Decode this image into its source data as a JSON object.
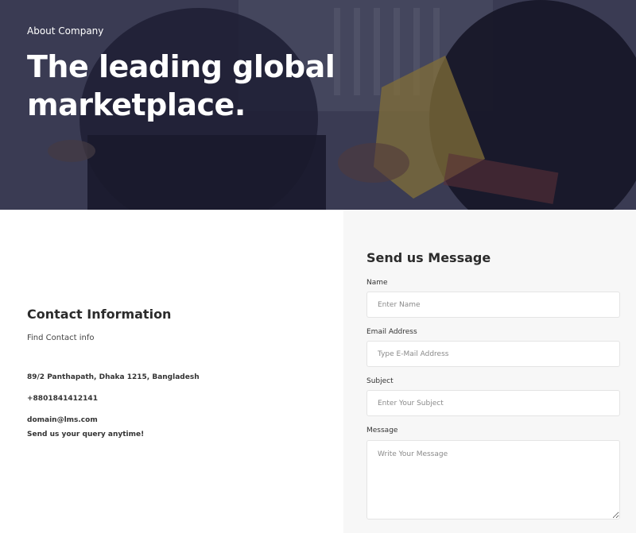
{
  "hero": {
    "eyebrow": "About Company",
    "title": "The leading global marketplace."
  },
  "contact": {
    "title": "Contact Information",
    "subtitle": "Find Contact info",
    "address": "89/2 Panthapath, Dhaka 1215, Bangladesh",
    "phone": "+8801841412141",
    "email": "domain@lms.com",
    "note": "Send us your query anytime!"
  },
  "form": {
    "title": "Send us Message",
    "name": {
      "label": "Name",
      "placeholder": "Enter Name"
    },
    "email": {
      "label": "Email Address",
      "placeholder": "Type E-Mail Address"
    },
    "subject": {
      "label": "Subject",
      "placeholder": "Enter Your Subject"
    },
    "message": {
      "label": "Message",
      "placeholder": "Write Your Message"
    }
  }
}
